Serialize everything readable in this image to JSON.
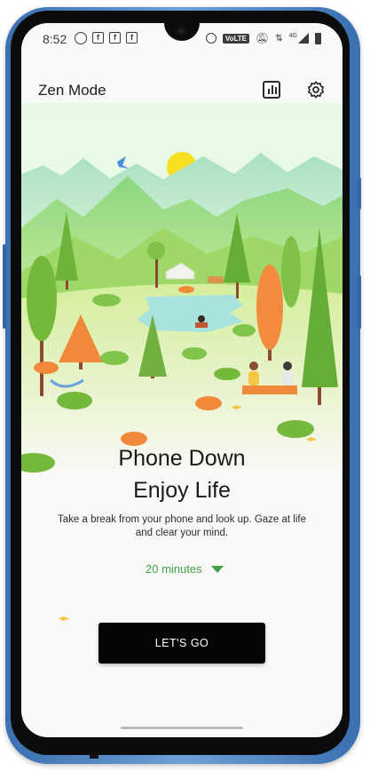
{
  "status_bar": {
    "time": "8:52",
    "network": "4G",
    "volte_label": "VoLTE",
    "left_icons": [
      "whatsapp-icon",
      "facebook-icon",
      "facebook-icon",
      "facebook-icon"
    ],
    "right_icons": [
      "hotspot-icon",
      "volte-icon",
      "mute-icon",
      "data-arrows-icon",
      "signal-icon",
      "battery-icon"
    ]
  },
  "app_bar": {
    "title": "Zen Mode",
    "stats_icon": "bar-chart-icon",
    "settings_icon": "gear-icon"
  },
  "main": {
    "headline_line1": "Phone Down",
    "headline_line2": "Enjoy Life",
    "description": "Take a break from your phone and look up. Gaze at life and clear your mind.",
    "duration": "20 minutes",
    "duration_icon": "dropdown-arrow-icon",
    "cta_label": "LET'S GO"
  },
  "colors": {
    "accent_green": "#3fa14a",
    "button_bg": "#050505",
    "sky": "#e6f8e4",
    "sun": "#f9df22"
  }
}
